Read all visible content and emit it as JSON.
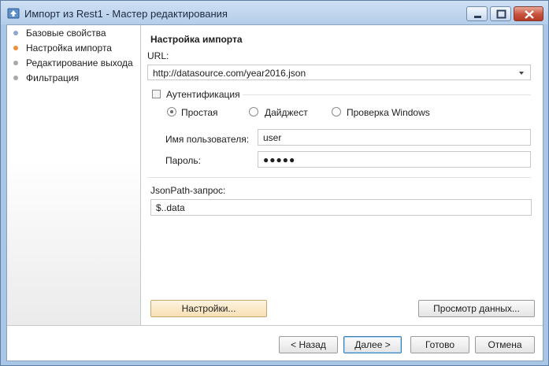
{
  "window": {
    "title": "Импорт из Rest1 - Мастер редактирования"
  },
  "sidebar": {
    "items": [
      {
        "label": "Базовые свойства",
        "color": "#8ea8cf"
      },
      {
        "label": "Настройка импорта",
        "color": "#f08f3a"
      },
      {
        "label": "Редактирование выхода",
        "color": "#a9a9a9"
      },
      {
        "label": "Фильтрация",
        "color": "#a9a9a9"
      }
    ]
  },
  "main": {
    "section_title": "Настройка импорта",
    "url_label": "URL:",
    "url_value": "http://datasource.com/year2016.json",
    "auth_label": "Аутентификация",
    "auth_options": [
      "Простая",
      "Дайджест",
      "Проверка Windows"
    ],
    "username_label": "Имя пользователя:",
    "username_value": "user",
    "password_label": "Пароль:",
    "password_value": "●●●●●",
    "jsonpath_label": "JsonPath-запрос:",
    "jsonpath_value": "$..data",
    "settings_button": "Настройки...",
    "preview_button": "Просмотр данных..."
  },
  "footer": {
    "back": "< Назад",
    "next": "Далее >",
    "finish": "Готово",
    "cancel": "Отмена"
  }
}
